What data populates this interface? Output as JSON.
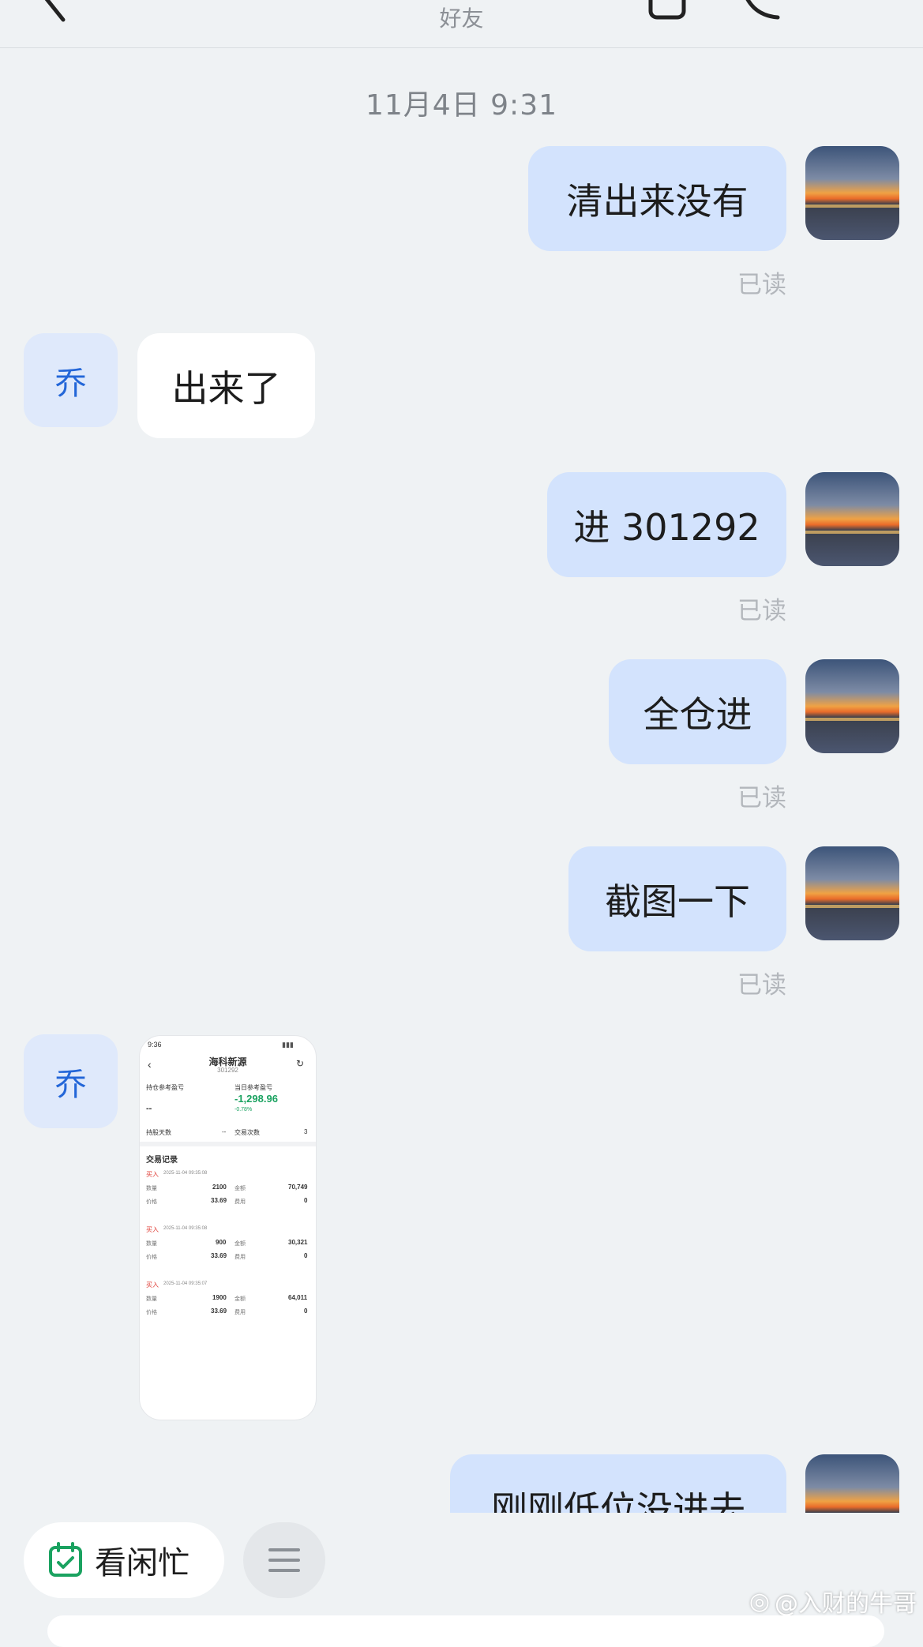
{
  "header": {
    "subtitle": "好友"
  },
  "timestamp": "11月4日 9:31",
  "read_label": "已读",
  "contact_initial": "乔",
  "messages": [
    {
      "text": "清出来没有"
    },
    {
      "text": "出来了"
    },
    {
      "text": "进 301292"
    },
    {
      "text": "全仓进"
    },
    {
      "text": "截图一下"
    },
    {
      "text": "刚刚低位没进去"
    }
  ],
  "shot": {
    "status_time": "9:36",
    "title": "海科新源",
    "code": "301292",
    "hold_label": "持仓参考盈亏",
    "hold_value": "--",
    "today_label": "当日参考盈亏",
    "today_value": "-1,298.96",
    "today_pct": "-0.78%",
    "days_label": "持股天数",
    "days_value": "--",
    "count_label": "交易次数",
    "count_value": "3",
    "records_title": "交易记录",
    "qty_label": "数量",
    "price_label": "价格",
    "amount_label": "金额",
    "fee_label": "费用",
    "records": [
      {
        "type": "买入",
        "time": "2025-11-04 09:35:08",
        "qty": "2100",
        "price": "33.69",
        "amount": "70,749",
        "fee": "0"
      },
      {
        "type": "买入",
        "time": "2025-11-04 09:35:08",
        "qty": "900",
        "price": "33.69",
        "amount": "30,321",
        "fee": "0"
      },
      {
        "type": "买入",
        "time": "2025-11-04 09:35:07",
        "qty": "1900",
        "price": "33.69",
        "amount": "64,011",
        "fee": "0"
      }
    ]
  },
  "bottom": {
    "busy_label": "看闲忙"
  },
  "watermark": "@入财的牛哥",
  "colors": {
    "bubble_out": "#d3e3fd",
    "accent_blue": "#2366d8",
    "green": "#1aa260",
    "red": "#e0413a"
  }
}
